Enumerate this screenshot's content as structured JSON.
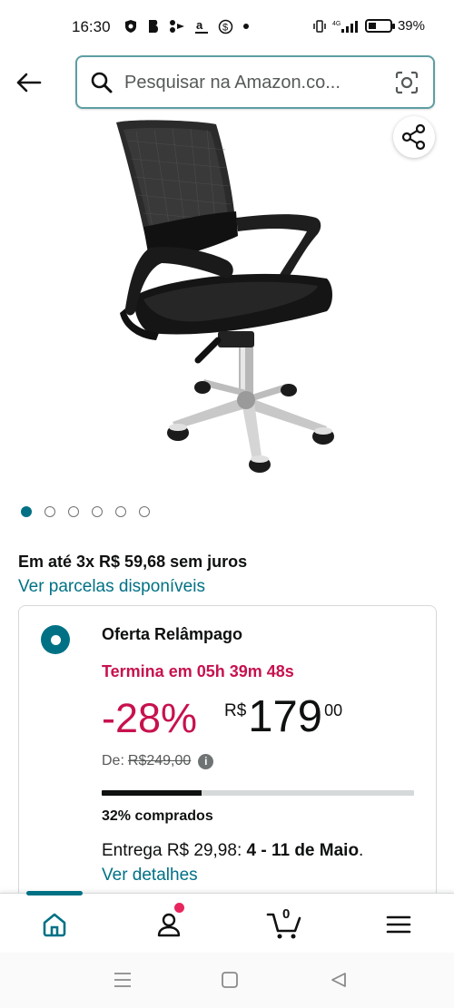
{
  "status_bar": {
    "time": "16:30",
    "battery": "39%",
    "network": "4G"
  },
  "search": {
    "placeholder": "Pesquisar na Amazon.co..."
  },
  "carousel": {
    "total_images": 6,
    "active_index": 0
  },
  "installments": {
    "text": "Em até 3x R$ 59,68 sem juros",
    "link": "Ver parcelas disponíveis"
  },
  "offer": {
    "title": "Oferta Relâmpago",
    "timer": "Termina em 05h 39m 48s",
    "discount": "-28%",
    "currency": "R$",
    "price_whole": "179",
    "price_cents": "00",
    "list_label": "De:",
    "list_price": "R$249,00",
    "progress_fraction": 0.32,
    "claimed_text": "32% comprados",
    "delivery_prefix": "Entrega R$ 29,98: ",
    "delivery_dates": "4 - 11 de Maio",
    "delivery_suffix": ".",
    "details_link": "Ver detalhes"
  },
  "bottom_nav": {
    "cart_count": "0",
    "active": "home"
  },
  "colors": {
    "accent": "#007185",
    "deal": "#c7124d",
    "search_border": "#5e9ea3",
    "notification": "#e8265e"
  },
  "icons": {
    "back": "arrow-left-icon",
    "search": "search-icon",
    "camera": "camera-scan-icon",
    "share": "share-icon",
    "info": "info-icon",
    "home": "home-icon",
    "account": "user-icon",
    "cart": "cart-icon",
    "menu": "hamburger-menu-icon"
  }
}
